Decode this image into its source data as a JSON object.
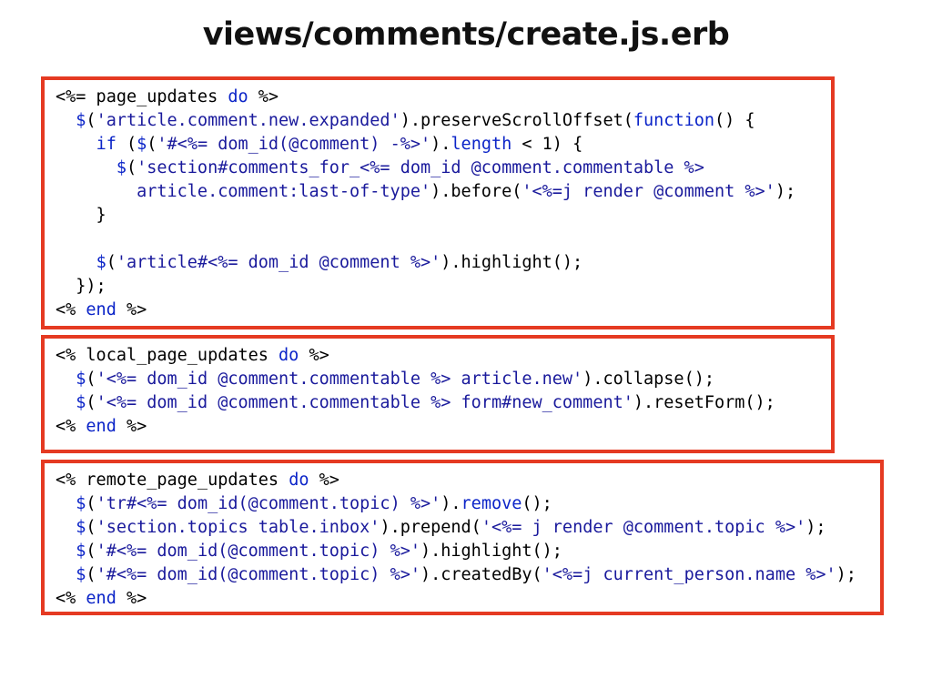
{
  "title": "views/comments/create.js.erb",
  "colors": {
    "box_border": "#e53a22",
    "keyword": "#0b24c8",
    "string": "#1a1a9c",
    "text": "#000000"
  },
  "code_blocks": [
    {
      "lines": [
        [
          {
            "t": "<%= page_updates ",
            "c": "erb"
          },
          {
            "t": "do",
            "c": "kw"
          },
          {
            "t": " %>",
            "c": "erb"
          }
        ],
        [
          {
            "t": "  ",
            "c": "erb"
          },
          {
            "t": "$",
            "c": "dollar"
          },
          {
            "t": "(",
            "c": "fn"
          },
          {
            "t": "'article.comment.new.expanded'",
            "c": "str"
          },
          {
            "t": ").preserveScrollOffset(",
            "c": "fn"
          },
          {
            "t": "function",
            "c": "kw"
          },
          {
            "t": "() {",
            "c": "fn"
          }
        ],
        [
          {
            "t": "    ",
            "c": "erb"
          },
          {
            "t": "if",
            "c": "kw"
          },
          {
            "t": " (",
            "c": "fn"
          },
          {
            "t": "$",
            "c": "dollar"
          },
          {
            "t": "(",
            "c": "fn"
          },
          {
            "t": "'#<%= dom_id(@comment) -%>'",
            "c": "str"
          },
          {
            "t": ").",
            "c": "fn"
          },
          {
            "t": "length",
            "c": "kw"
          },
          {
            "t": " < 1) {",
            "c": "fn"
          }
        ],
        [
          {
            "t": "      ",
            "c": "erb"
          },
          {
            "t": "$",
            "c": "dollar"
          },
          {
            "t": "(",
            "c": "fn"
          },
          {
            "t": "'section#comments_for_<%= dom_id @comment.commentable %>",
            "c": "str"
          }
        ],
        [
          {
            "t": "        article.comment:last-of-type'",
            "c": "str"
          },
          {
            "t": ").before(",
            "c": "fn"
          },
          {
            "t": "'<%=j render @comment %>'",
            "c": "str"
          },
          {
            "t": ");",
            "c": "fn"
          }
        ],
        [
          {
            "t": "    }",
            "c": "fn"
          }
        ],
        [
          {
            "t": "",
            "c": "fn"
          }
        ],
        [
          {
            "t": "    ",
            "c": "erb"
          },
          {
            "t": "$",
            "c": "dollar"
          },
          {
            "t": "(",
            "c": "fn"
          },
          {
            "t": "'article#<%= dom_id @comment %>'",
            "c": "str"
          },
          {
            "t": ").highlight();",
            "c": "fn"
          }
        ],
        [
          {
            "t": "  });",
            "c": "fn"
          }
        ],
        [
          {
            "t": "<% ",
            "c": "erb"
          },
          {
            "t": "end",
            "c": "kw"
          },
          {
            "t": " %>",
            "c": "erb"
          }
        ]
      ]
    },
    {
      "lines": [
        [
          {
            "t": "<% local_page_updates ",
            "c": "erb"
          },
          {
            "t": "do",
            "c": "kw"
          },
          {
            "t": " %>",
            "c": "erb"
          }
        ],
        [
          {
            "t": "  ",
            "c": "erb"
          },
          {
            "t": "$",
            "c": "dollar"
          },
          {
            "t": "(",
            "c": "fn"
          },
          {
            "t": "'<%= dom_id @comment.commentable %> article.new'",
            "c": "str"
          },
          {
            "t": ").collapse();",
            "c": "fn"
          }
        ],
        [
          {
            "t": "  ",
            "c": "erb"
          },
          {
            "t": "$",
            "c": "dollar"
          },
          {
            "t": "(",
            "c": "fn"
          },
          {
            "t": "'<%= dom_id @comment.commentable %> form#new_comment'",
            "c": "str"
          },
          {
            "t": ").resetForm();",
            "c": "fn"
          }
        ],
        [
          {
            "t": "<% ",
            "c": "erb"
          },
          {
            "t": "end",
            "c": "kw"
          },
          {
            "t": " %>",
            "c": "erb"
          }
        ]
      ]
    },
    {
      "lines": [
        [
          {
            "t": "<% remote_page_updates ",
            "c": "erb"
          },
          {
            "t": "do",
            "c": "kw"
          },
          {
            "t": " %>",
            "c": "erb"
          }
        ],
        [
          {
            "t": "  ",
            "c": "erb"
          },
          {
            "t": "$",
            "c": "dollar"
          },
          {
            "t": "(",
            "c": "fn"
          },
          {
            "t": "'tr#<%= dom_id(@comment.topic) %>'",
            "c": "str"
          },
          {
            "t": ").",
            "c": "fn"
          },
          {
            "t": "remove",
            "c": "kw"
          },
          {
            "t": "();",
            "c": "fn"
          }
        ],
        [
          {
            "t": "  ",
            "c": "erb"
          },
          {
            "t": "$",
            "c": "dollar"
          },
          {
            "t": "(",
            "c": "fn"
          },
          {
            "t": "'section.topics table.inbox'",
            "c": "str"
          },
          {
            "t": ").prepend(",
            "c": "fn"
          },
          {
            "t": "'<%= j render @comment.topic %>'",
            "c": "str"
          },
          {
            "t": ");",
            "c": "fn"
          }
        ],
        [
          {
            "t": "  ",
            "c": "erb"
          },
          {
            "t": "$",
            "c": "dollar"
          },
          {
            "t": "(",
            "c": "fn"
          },
          {
            "t": "'#<%= dom_id(@comment.topic) %>'",
            "c": "str"
          },
          {
            "t": ").highlight();",
            "c": "fn"
          }
        ],
        [
          {
            "t": "  ",
            "c": "erb"
          },
          {
            "t": "$",
            "c": "dollar"
          },
          {
            "t": "(",
            "c": "fn"
          },
          {
            "t": "'#<%= dom_id(@comment.topic) %>'",
            "c": "str"
          },
          {
            "t": ").createdBy(",
            "c": "fn"
          },
          {
            "t": "'<%=j current_person.name %>'",
            "c": "str"
          },
          {
            "t": ");",
            "c": "fn"
          }
        ],
        [
          {
            "t": "<% ",
            "c": "erb"
          },
          {
            "t": "end",
            "c": "kw"
          },
          {
            "t": " %>",
            "c": "erb"
          }
        ]
      ]
    }
  ]
}
